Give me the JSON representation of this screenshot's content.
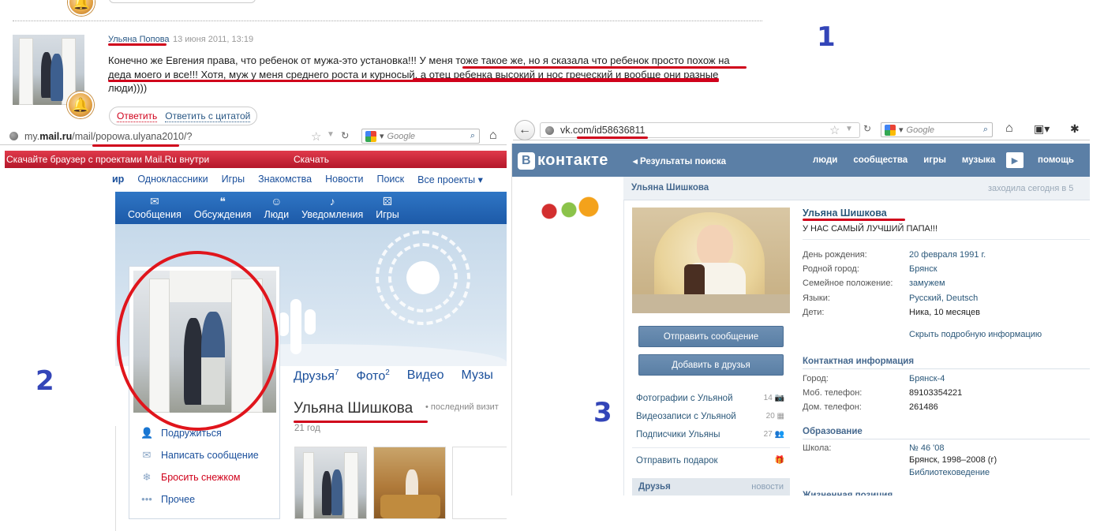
{
  "colors": {
    "accent_red": "#d0021b",
    "label_blue": "#3345b8",
    "vk_blue": "#5b7fa6",
    "mail_blue": "#1d5aa8"
  },
  "labels": {
    "one": "1",
    "two": "2",
    "three": "3"
  },
  "panel1": {
    "author": "Ульяна Попова",
    "date": "13 июня 2011, 13:19",
    "text": "Конечно же Евгения права, что ребенок от мужа-это установка!!! У меня тоже такое же, но я сказала что ребенок просто похож на деда моего и все!!! Хотя, муж у меня среднего роста и курносый, а отец ребенка высокий и нос греческий и вообще они разные люди))))",
    "reply": "Ответить",
    "reply_quote": "Ответить с цитатой",
    "icon": "bell-icon"
  },
  "panel2": {
    "url_host": "my.mail.ru",
    "url_prefix": "my.",
    "url_bold": "mail.ru",
    "url_mid": "/mail/",
    "url_id": "popowa.ulyana2010",
    "url_tail": "/?",
    "search_placeholder": "Google",
    "banner": "Скачайте браузер с проектами Mail.Ru внутри",
    "banner_btn": "Скачать",
    "menu": [
      "ир",
      "Одноклассники",
      "Игры",
      "Знакомства",
      "Новости",
      "Поиск",
      "Все проекты ▾"
    ],
    "nav": [
      {
        "icon": "✉",
        "label": "Сообщения"
      },
      {
        "icon": "❝",
        "label": "Обсуждения"
      },
      {
        "icon": "☺",
        "label": "Люди"
      },
      {
        "icon": "♪",
        "label": "Уведомления"
      },
      {
        "icon": "⚄",
        "label": "Игры"
      }
    ],
    "actions": [
      {
        "icon": "👤",
        "label": "Подружиться"
      },
      {
        "icon": "✉",
        "label": "Написать сообщение"
      },
      {
        "icon": "❄",
        "label": "Бросить снежком"
      },
      {
        "icon": "•••",
        "label": "Прочее"
      }
    ],
    "tabs": [
      {
        "label": "Друзья",
        "count": "7"
      },
      {
        "label": "Фото",
        "count": "2"
      },
      {
        "label": "Видео",
        "count": ""
      },
      {
        "label": "Музы",
        "count": ""
      }
    ],
    "name": "Ульяна Шишкова",
    "last_visit": "• последний визит",
    "age": "21 год"
  },
  "panel3": {
    "url_host": "vk.com/",
    "url_id": "id58636811",
    "search_placeholder": "Google",
    "logo_b": "В",
    "logo_text": "контакте",
    "crumb": "◂ Результаты поиска",
    "menu": [
      "люди",
      "сообщества",
      "игры",
      "музыка"
    ],
    "help": "помощь",
    "header_name": "Ульяна Шишкова",
    "header_seen": "заходила сегодня в 5",
    "name": "Ульяна Шишкова",
    "status": "У НАС САМЫЙ ЛУЧШИЙ ПАПА!!!",
    "btn_message": "Отправить сообщение",
    "btn_add": "Добавить в друзья",
    "side": [
      {
        "label": "Фотографии с Ульяной",
        "count": "14"
      },
      {
        "label": "Видеозаписи с Ульяной",
        "count": "20"
      },
      {
        "label": "Подписчики Ульяны",
        "count": "27"
      },
      {
        "label": "Отправить подарок",
        "count": ""
      }
    ],
    "friends": "Друзья",
    "friends_new": "новости",
    "info": [
      {
        "k": "День рождения:",
        "v": "20 февраля 1991 г."
      },
      {
        "k": "Родной город:",
        "v": "Брянск"
      },
      {
        "k": "Семейное положение:",
        "v": "замужем"
      },
      {
        "k": "Языки:",
        "v": "Русский, Deutsch"
      },
      {
        "k": "Дети:",
        "v": "Ника, 10 месяцев"
      }
    ],
    "hide_info": "Скрыть подробную информацию",
    "contact_title": "Контактная информация",
    "contacts": [
      {
        "k": "Город:",
        "v": "Брянск-4"
      },
      {
        "k": "Моб. телефон:",
        "v": "89103354221"
      },
      {
        "k": "Дом. телефон:",
        "v": "261486"
      }
    ],
    "edu_title": "Образование",
    "school_k": "Школа:",
    "school_v1": "№ 46 '08",
    "school_v2": "Брянск, 1998–2008 (г)",
    "school_v3": "Библиотековедение",
    "life_title": "Жизненная позиция"
  }
}
